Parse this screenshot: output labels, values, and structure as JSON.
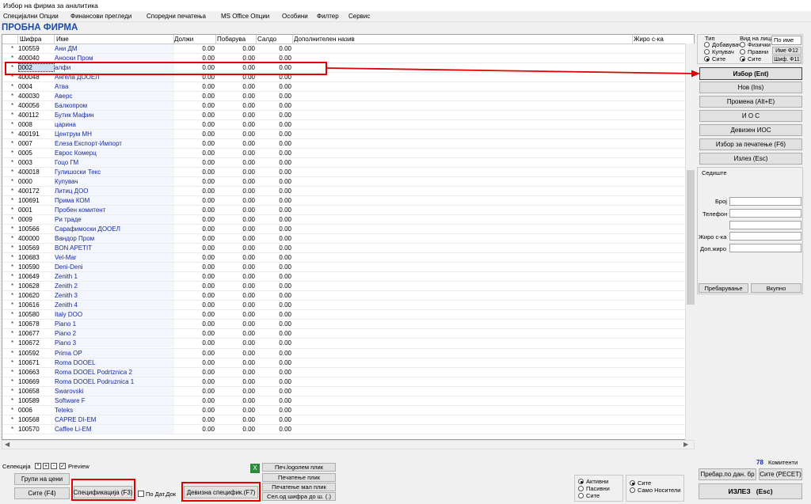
{
  "window": {
    "title": "Избор на фирма за аналитика"
  },
  "menu": [
    "Специјални Опции",
    "Финансови прегледи",
    "Споредни печатења",
    "MS Office Опции",
    "Особини",
    "Филтер",
    "Сервис"
  ],
  "company_title": "ПРОБНА ФИРМА",
  "grid": {
    "headers": {
      "code": "Шифра",
      "name": "Име",
      "dolzi": "Должи",
      "pobaruva": "Побарува",
      "saldo": "Салдо",
      "additional": "Дополнителен назив",
      "ziro": "Жиро с-ка"
    },
    "rows": [
      {
        "code": "100559",
        "name": "Ани ДМ",
        "d": "0.00",
        "p": "0.00",
        "s": "0.00"
      },
      {
        "code": "400040",
        "name": "Аноски Пром",
        "d": "0.00",
        "p": "0.00",
        "s": "0.00"
      },
      {
        "code": "0002",
        "name": "алфи",
        "d": "0.00",
        "p": "0.00",
        "s": "0.00"
      },
      {
        "code": "400048",
        "name": "Ангела ДООЕЛ",
        "d": "0.00",
        "p": "0.00",
        "s": "0.00"
      },
      {
        "code": "0004",
        "name": "Атва",
        "d": "0.00",
        "p": "0.00",
        "s": "0.00"
      },
      {
        "code": "400030",
        "name": "Аверс",
        "d": "0.00",
        "p": "0.00",
        "s": "0.00"
      },
      {
        "code": "400056",
        "name": "Балкопром",
        "d": "0.00",
        "p": "0.00",
        "s": "0.00"
      },
      {
        "code": "400112",
        "name": "Бутик Мафин",
        "d": "0.00",
        "p": "0.00",
        "s": "0.00"
      },
      {
        "code": "0008",
        "name": "царина",
        "d": "0.00",
        "p": "0.00",
        "s": "0.00"
      },
      {
        "code": "400191",
        "name": "Центрум МН",
        "d": "0.00",
        "p": "0.00",
        "s": "0.00"
      },
      {
        "code": "0007",
        "name": "Елеза Експорт-Импорт",
        "d": "0.00",
        "p": "0.00",
        "s": "0.00"
      },
      {
        "code": "0005",
        "name": "Еврос Комерц",
        "d": "0.00",
        "p": "0.00",
        "s": "0.00"
      },
      {
        "code": "0003",
        "name": "Гоцо ГМ",
        "d": "0.00",
        "p": "0.00",
        "s": "0.00"
      },
      {
        "code": "400018",
        "name": "Гулишоски Текс",
        "d": "0.00",
        "p": "0.00",
        "s": "0.00"
      },
      {
        "code": "0000",
        "name": "Купувач",
        "d": "0.00",
        "p": "0.00",
        "s": "0.00"
      },
      {
        "code": "400172",
        "name": "Литиц ДОО",
        "d": "0.00",
        "p": "0.00",
        "s": "0.00"
      },
      {
        "code": "100691",
        "name": "Прима КОМ",
        "d": "0.00",
        "p": "0.00",
        "s": "0.00"
      },
      {
        "code": "0001",
        "name": "Пробен комитент",
        "d": "0.00",
        "p": "0.00",
        "s": "0.00"
      },
      {
        "code": "0009",
        "name": "Ри траде",
        "d": "0.00",
        "p": "0.00",
        "s": "0.00"
      },
      {
        "code": "100566",
        "name": "Сарафимоски ДООЕЛ",
        "d": "0.00",
        "p": "0.00",
        "s": "0.00"
      },
      {
        "code": "400000",
        "name": "Вандор Пром",
        "d": "0.00",
        "p": "0.00",
        "s": "0.00"
      },
      {
        "code": "100569",
        "name": "BON APETIT",
        "d": "0.00",
        "p": "0.00",
        "s": "0.00"
      },
      {
        "code": "100683",
        "name": "Vel-Mar",
        "d": "0.00",
        "p": "0.00",
        "s": "0.00"
      },
      {
        "code": "100590",
        "name": "Deni-Deni",
        "d": "0.00",
        "p": "0.00",
        "s": "0.00"
      },
      {
        "code": "100649",
        "name": "Zenith 1",
        "d": "0.00",
        "p": "0.00",
        "s": "0.00"
      },
      {
        "code": "100628",
        "name": "Zenith 2",
        "d": "0.00",
        "p": "0.00",
        "s": "0.00"
      },
      {
        "code": "100620",
        "name": "Zenith 3",
        "d": "0.00",
        "p": "0.00",
        "s": "0.00"
      },
      {
        "code": "100616",
        "name": "Zenith 4",
        "d": "0.00",
        "p": "0.00",
        "s": "0.00"
      },
      {
        "code": "100580",
        "name": "Italy DOO",
        "d": "0.00",
        "p": "0.00",
        "s": "0.00"
      },
      {
        "code": "100678",
        "name": "Piano 1",
        "d": "0.00",
        "p": "0.00",
        "s": "0.00"
      },
      {
        "code": "100677",
        "name": "Piano 2",
        "d": "0.00",
        "p": "0.00",
        "s": "0.00"
      },
      {
        "code": "100672",
        "name": "Piano 3",
        "d": "0.00",
        "p": "0.00",
        "s": "0.00"
      },
      {
        "code": "100592",
        "name": "Prima OP",
        "d": "0.00",
        "p": "0.00",
        "s": "0.00"
      },
      {
        "code": "100671",
        "name": "Roma DOOEL",
        "d": "0.00",
        "p": "0.00",
        "s": "0.00"
      },
      {
        "code": "100663",
        "name": "Roma DOOEL Podrtznica 2",
        "d": "0.00",
        "p": "0.00",
        "s": "0.00"
      },
      {
        "code": "100669",
        "name": "Roma DOOEL Podruznica 1",
        "d": "0.00",
        "p": "0.00",
        "s": "0.00"
      },
      {
        "code": "100658",
        "name": "Swarovski",
        "d": "0.00",
        "p": "0.00",
        "s": "0.00"
      },
      {
        "code": "100589",
        "name": "Software F",
        "d": "0.00",
        "p": "0.00",
        "s": "0.00"
      },
      {
        "code": "0006",
        "name": "Teteks",
        "d": "0.00",
        "p": "0.00",
        "s": "0.00"
      },
      {
        "code": "100568",
        "name": "CAPRE DI-EM",
        "d": "0.00",
        "p": "0.00",
        "s": "0.00"
      },
      {
        "code": "100570",
        "name": "Caffee Li-EM",
        "d": "0.00",
        "p": "0.00",
        "s": "0.00"
      }
    ]
  },
  "filters": {
    "tip_label": "Тип",
    "tip_options": [
      "Добавувач",
      "Купувач",
      "Сите"
    ],
    "vid_label": "Вид на лица",
    "vid_options": [
      "Физички",
      "Правни",
      "Сите"
    ],
    "search_mode": "По име",
    "ime_btn": "Име Ф12",
    "sif_btn": "Шиф. Ф11"
  },
  "actions": [
    "Избор (Ent)",
    "Нов (Ins)",
    "Промена (Alt+E)",
    "И О С",
    "Девизен ИОС",
    "Избор за печатење (F6)",
    "Излез (Esc)"
  ],
  "details": {
    "sediste": "Седиште",
    "broj": "Број",
    "telefon": "Телефон",
    "ziro": "Жиро с-ка",
    "dop_ziro": "Доп.жиро",
    "search_btn": "Пребарување",
    "total_btn": "Вкупно"
  },
  "bottom": {
    "selekcija": "Селекција",
    "preview": "Preview",
    "grupi": "Групи на цени",
    "site_f4": "Сите (F4)",
    "spec_f3": "Спецификација (F3)",
    "po_dat": "По Дат.Док",
    "dev_spec": "Девизна специфик.(F7)",
    "print_buttons": [
      "Печ.logолем плик",
      "Печатење плик",
      "Печатење мал плик",
      "Сел.од шифра до ш. (.)"
    ],
    "status_options": [
      "Активни",
      "Пасивни",
      "Сите"
    ],
    "carrier_options": [
      "Сите",
      "Само Носители"
    ],
    "count_value": "78",
    "count_label": "Комитенти",
    "prebar_dan": "Пребар.по дан. бр",
    "site_reset": "Сите (РЕСЕТ)",
    "izlez": "ИЗЛЕЗ   (Esc)"
  }
}
